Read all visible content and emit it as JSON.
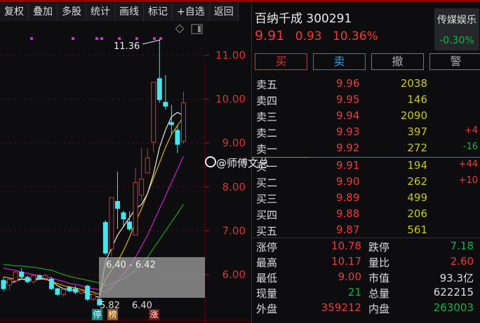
{
  "toolbar": [
    "复权",
    "叠加",
    "多股",
    "统计",
    "画线",
    "标记",
    "+自选",
    "返回"
  ],
  "chart": {
    "price_labels": [
      "11.00",
      "10.00",
      "9.00",
      "8.00",
      "7.00",
      "6.00"
    ],
    "price_values": [
      11,
      10,
      9,
      8,
      7,
      6
    ],
    "high_annotation": "11.36",
    "low_annotation": "5.82",
    "low_annotation2": "6.40",
    "range_text": "6.40 - 6.42",
    "badges": [
      "停",
      "榜",
      "涨"
    ],
    "colors": {
      "up": "#e03030",
      "down": "#40e8f0",
      "ma5": "#e8e8e8",
      "ma10": "#e0b000",
      "ma20": "#d020d0",
      "ma30": "#20a020"
    },
    "candles": [
      [
        5.87,
        5.95,
        5.62,
        5.68
      ],
      [
        5.76,
        5.95,
        5.65,
        5.89
      ],
      [
        5.86,
        6.1,
        5.8,
        6.06
      ],
      [
        6.06,
        6.15,
        5.9,
        5.95
      ],
      [
        5.94,
        5.98,
        5.8,
        5.84
      ],
      [
        5.84,
        6.02,
        5.8,
        5.98
      ],
      [
        5.98,
        6.0,
        5.88,
        5.92
      ],
      [
        5.92,
        6.02,
        5.85,
        5.98
      ],
      [
        5.9,
        5.95,
        5.65,
        5.68
      ],
      [
        5.68,
        5.7,
        5.52,
        5.55
      ],
      [
        5.55,
        5.7,
        5.5,
        5.66
      ],
      [
        5.71,
        5.75,
        5.6,
        5.63
      ],
      [
        5.68,
        5.75,
        5.55,
        5.6
      ],
      [
        5.58,
        5.68,
        5.55,
        5.63
      ],
      [
        5.74,
        5.77,
        5.4,
        5.44
      ],
      [
        5.44,
        5.58,
        5.4,
        5.55
      ],
      [
        5.44,
        5.46,
        5.28,
        5.31
      ],
      [
        7.19,
        7.24,
        6.44,
        6.49
      ],
      [
        6.58,
        7.76,
        6.41,
        7.76
      ],
      [
        7.67,
        8.35,
        7.04,
        7.51
      ],
      [
        7.41,
        7.46,
        7.11,
        7.27
      ],
      [
        7.2,
        7.44,
        7.0,
        7.04
      ],
      [
        6.9,
        8.43,
        6.9,
        8.1
      ],
      [
        7.81,
        8.88,
        7.68,
        8.18
      ],
      [
        8.32,
        8.88,
        8.32,
        8.66
      ],
      [
        9.02,
        10.39,
        8.78,
        10.39
      ],
      [
        10.47,
        11.36,
        9.92,
        9.99
      ],
      [
        9.93,
        10.55,
        9.76,
        9.84
      ],
      [
        9.47,
        9.87,
        9.2,
        9.42
      ],
      [
        9.29,
        9.42,
        8.77,
        8.97
      ],
      [
        9.04,
        10.17,
        8.99,
        9.92
      ]
    ],
    "ma5": [
      5.85,
      5.8,
      5.85,
      5.9,
      5.88,
      5.87,
      5.9,
      5.9,
      5.85,
      5.75,
      5.68,
      5.66,
      5.64,
      5.62,
      5.58,
      5.52,
      5.48,
      6.3,
      6.6,
      6.9,
      7.1,
      7.3,
      7.5,
      7.6,
      7.85,
      8.3,
      8.9,
      9.3,
      9.6,
      9.7,
      9.63
    ],
    "ma10": [
      5.95,
      5.92,
      5.9,
      5.9,
      5.9,
      5.9,
      5.92,
      5.9,
      5.85,
      5.8,
      5.75,
      5.72,
      5.7,
      5.66,
      5.62,
      5.6,
      5.55,
      5.9,
      6.1,
      6.3,
      6.55,
      6.85,
      7.2,
      7.5,
      7.85,
      8.2,
      8.55,
      8.9,
      9.2,
      9.4,
      9.6
    ],
    "ma20": [
      6.15,
      6.12,
      6.1,
      6.05,
      6.03,
      6.0,
      5.98,
      5.95,
      5.92,
      5.88,
      5.85,
      5.8,
      5.78,
      5.75,
      5.7,
      5.68,
      5.66,
      5.6,
      5.7,
      5.85,
      6.0,
      6.2,
      6.4,
      6.65,
      6.9,
      7.2,
      7.5,
      7.8,
      8.1,
      8.4,
      8.7
    ],
    "ma30": [
      6.23,
      6.22,
      6.2,
      6.2,
      6.18,
      6.17,
      6.15,
      6.12,
      6.1,
      6.05,
      6.0,
      5.96,
      5.93,
      5.9,
      5.87,
      5.84,
      5.81,
      5.75,
      5.8,
      5.85,
      5.9,
      6.0,
      6.1,
      6.25,
      6.4,
      6.6,
      6.8,
      7.0,
      7.2,
      7.4,
      7.6
    ]
  },
  "quote": {
    "name_code": "百纳千成 300291",
    "price": "9.91",
    "change": "0.93",
    "pct": "10.36%",
    "sector": "传媒娱乐",
    "sector_pct": "-0.30%"
  },
  "actions": [
    "买",
    "卖",
    "撤",
    "警"
  ],
  "orderbook": [
    {
      "label": "卖五",
      "price": "9.96",
      "vol": "2038",
      "delta": ""
    },
    {
      "label": "卖四",
      "price": "9.95",
      "vol": "146",
      "delta": ""
    },
    {
      "label": "卖三",
      "price": "9.94",
      "vol": "2090",
      "delta": ""
    },
    {
      "label": "卖二",
      "price": "9.93",
      "vol": "397",
      "delta": "+4"
    },
    {
      "label": "卖一",
      "price": "9.92",
      "vol": "272",
      "delta": "-16"
    },
    {
      "label": "买一",
      "price": "9.91",
      "vol": "194",
      "delta": "+44"
    },
    {
      "label": "买二",
      "price": "9.90",
      "vol": "262",
      "delta": "+10"
    },
    {
      "label": "买三",
      "price": "9.89",
      "vol": "499",
      "delta": ""
    },
    {
      "label": "买四",
      "price": "9.88",
      "vol": "206",
      "delta": ""
    },
    {
      "label": "买五",
      "price": "9.87",
      "vol": "561",
      "delta": ""
    }
  ],
  "stats": [
    {
      "label": "涨停",
      "value": "10.78",
      "color": "#f03a3a"
    },
    {
      "label": "跌停",
      "value": "7.18",
      "color": "#19b34a"
    },
    {
      "label": "最高",
      "value": "10.17",
      "color": "#f03a3a"
    },
    {
      "label": "量比",
      "value": "2.60",
      "color": "#f03a3a"
    },
    {
      "label": "最低",
      "value": "9.00",
      "color": "#f03a3a"
    },
    {
      "label": "市值",
      "value": "93.3亿",
      "color": "#ddd"
    },
    {
      "label": "现量",
      "value": "21",
      "color": "#19b34a"
    },
    {
      "label": "总量",
      "value": "622215",
      "color": "#ddd"
    },
    {
      "label": "外盘",
      "value": "359212",
      "color": "#f03a3a"
    },
    {
      "label": "内盘",
      "value": "263003",
      "color": "#19b34a"
    }
  ],
  "watermark": "@师傅文总"
}
